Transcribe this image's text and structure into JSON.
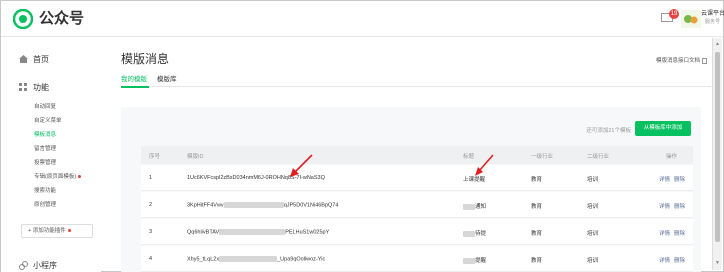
{
  "header": {
    "brand": "公众号",
    "mail_badge": "19",
    "account_name": "云课平台",
    "account_type": "服务号"
  },
  "sidebar": {
    "home": "首页",
    "function_section": "功能",
    "items": [
      {
        "label": "自动回复",
        "active": false,
        "dot": false
      },
      {
        "label": "自定义菜单",
        "active": false,
        "dot": false
      },
      {
        "label": "模板消息",
        "active": true,
        "dot": false
      },
      {
        "label": "留言管理",
        "active": false,
        "dot": false
      },
      {
        "label": "投票管理",
        "active": false,
        "dot": false
      },
      {
        "label": "专辑(原页面模板)",
        "active": false,
        "dot": true
      },
      {
        "label": "搜索功能",
        "active": false,
        "dot": false
      },
      {
        "label": "原创管理",
        "active": false,
        "dot": false
      }
    ],
    "add_plugin": "添加功能插件",
    "mini_program": "小程序"
  },
  "main": {
    "title": "模版消息",
    "doc_link": "模版消息接口文档",
    "tabs": [
      {
        "label": "我的模版",
        "active": true
      },
      {
        "label": "模版库",
        "active": false
      }
    ],
    "count_info": "还可添加21个模板",
    "add_button": "从模板库中添加"
  },
  "table": {
    "headers": [
      "序号",
      "模版ID",
      "标题",
      "一级行业",
      "二级行业",
      "操作"
    ],
    "rows": [
      {
        "no": "1",
        "id": "1Uc6KVFcspl2zBsD034nmM6J-0ROHNq8S-7I-wNaS3Q",
        "title": "上课提醒",
        "industry1": "教育",
        "industry2": "培训",
        "op_detail": "详情",
        "op_delete": "删除"
      },
      {
        "no": "2",
        "id_prefix": "3KpHitFF4Vwv",
        "id_suffix": "qJP5D0V1Ni46BpQ74",
        "title_suffix": "通知",
        "industry1": "教育",
        "industry2": "培训",
        "op_detail": "详情",
        "op_delete": "删除"
      },
      {
        "no": "3",
        "id_prefix": "Qq6hlivBTAV",
        "id_suffix": "PELHuS1w025pY",
        "title_suffix": "待提",
        "industry1": "教育",
        "industry2": "培训",
        "op_detail": "详情",
        "op_delete": "删除"
      },
      {
        "no": "4",
        "id_prefix": "Xhy5_tLqL2x",
        "id_suffix": "_Upa9qOollwoz-Yic",
        "title_suffix": "提醒",
        "industry1": "教育",
        "industry2": "培训",
        "op_detail": "详情",
        "op_delete": "删除"
      }
    ]
  },
  "colors": {
    "accent": "#07c160",
    "link": "#576b95",
    "badge": "#e64340",
    "annotation_arrow": "#e02020"
  },
  "icons": [
    "wechat-logo-icon",
    "mail-icon",
    "home-icon",
    "grid-icon",
    "plus-icon",
    "link-icon",
    "doc-icon"
  ]
}
